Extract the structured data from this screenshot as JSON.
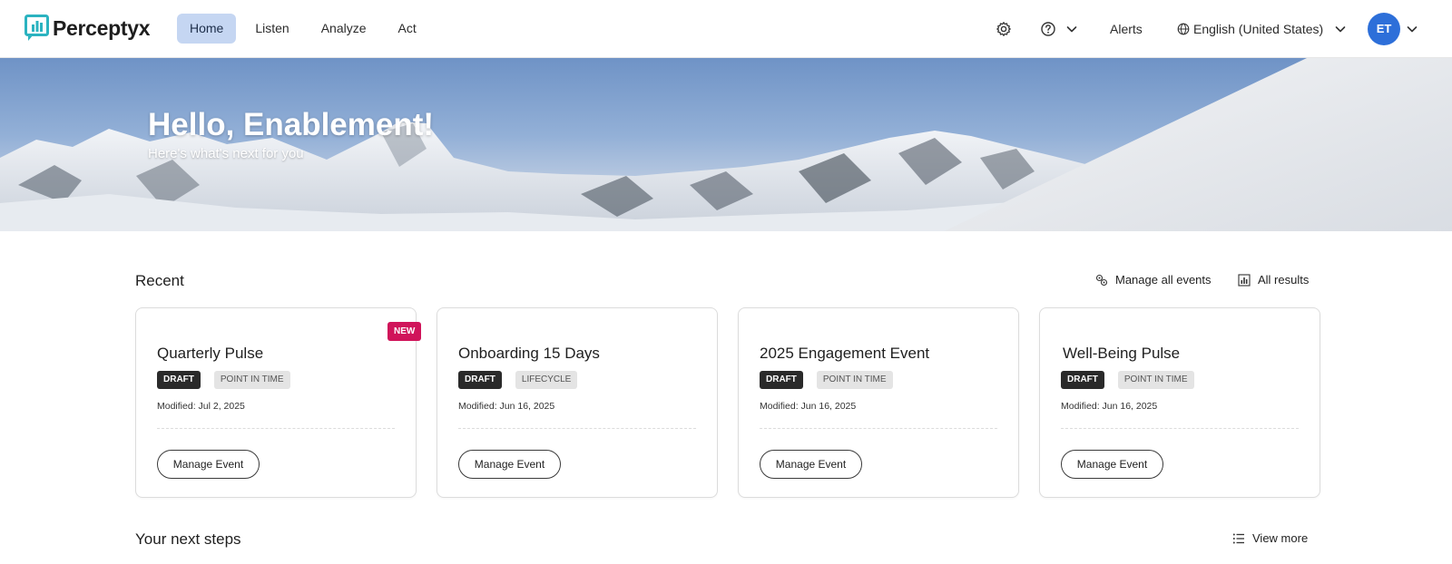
{
  "brand": {
    "name": "Perceptyx",
    "logo_color": "#2bb3c0"
  },
  "nav": {
    "items": [
      {
        "label": "Home",
        "active": true
      },
      {
        "label": "Listen",
        "active": false
      },
      {
        "label": "Analyze",
        "active": false
      },
      {
        "label": "Act",
        "active": false
      }
    ]
  },
  "header_tools": {
    "settings_icon": "gear-icon",
    "help_icon": "question-circle-icon",
    "alerts_label": "Alerts",
    "language_label": "English (United States)",
    "avatar_initials": "ET",
    "avatar_color": "#2d6fd9"
  },
  "hero": {
    "title": "Hello, Enablement!",
    "subtitle": "Here's what's next for you"
  },
  "recent": {
    "title": "Recent",
    "manage_all_label": "Manage all events",
    "all_results_label": "All results",
    "cards": [
      {
        "title": "Quarterly Pulse",
        "status": "DRAFT",
        "type": "POINT IN TIME",
        "modified": "Modified: Jul 2, 2025",
        "button": "Manage Event",
        "new_badge": "NEW"
      },
      {
        "title": "Onboarding 15 Days",
        "status": "DRAFT",
        "type": "LIFECYCLE",
        "modified": "Modified: Jun 16, 2025",
        "button": "Manage Event"
      },
      {
        "title": "2025 Engagement Event",
        "status": "DRAFT",
        "type": "POINT IN TIME",
        "modified": "Modified: Jun 16, 2025",
        "button": "Manage Event"
      },
      {
        "title": "Well-Being Pulse",
        "status": "DRAFT",
        "type": "POINT IN TIME",
        "modified": "Modified: Jun 16, 2025",
        "button": "Manage Event"
      }
    ]
  },
  "next_steps": {
    "title": "Your next steps",
    "view_more_label": "View more"
  }
}
